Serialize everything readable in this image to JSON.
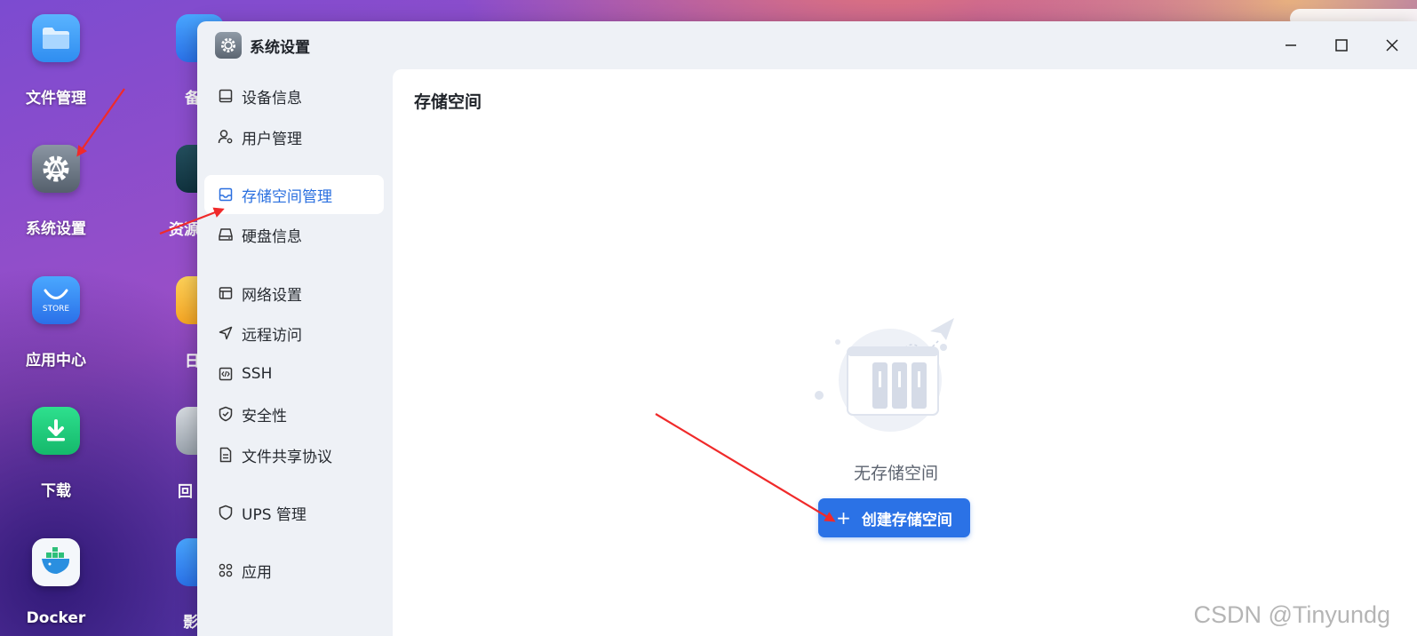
{
  "desktop": {
    "icons": [
      {
        "label": "文件管理",
        "icon": "folder-icon"
      },
      {
        "label": "系统设置",
        "icon": "gear-icon"
      },
      {
        "label": "应用中心",
        "icon": "store-icon"
      },
      {
        "label": "下载",
        "icon": "download-icon"
      },
      {
        "label": "Docker",
        "icon": "docker-icon"
      }
    ],
    "store_text": "STORE",
    "col2_labels": [
      "备",
      "资源",
      "日",
      "回",
      "影"
    ]
  },
  "window": {
    "title": "系统设置",
    "controls": {
      "minimize": "minimize-icon",
      "maximize": "maximize-icon",
      "close": "close-icon"
    }
  },
  "sidebar": {
    "items": [
      {
        "label": "设备信息",
        "icon": "device-icon"
      },
      {
        "label": "用户管理",
        "icon": "user-gear-icon"
      },
      {
        "label": "存储空间管理",
        "icon": "storage-icon",
        "active": true
      },
      {
        "label": "硬盘信息",
        "icon": "disk-icon"
      },
      {
        "label": "网络设置",
        "icon": "network-icon"
      },
      {
        "label": "远程访问",
        "icon": "remote-icon"
      },
      {
        "label": "SSH",
        "icon": "ssh-icon"
      },
      {
        "label": "安全性",
        "icon": "shield-check-icon"
      },
      {
        "label": "文件共享协议",
        "icon": "document-icon"
      },
      {
        "label": "UPS 管理",
        "icon": "shield-icon"
      },
      {
        "label": "应用",
        "icon": "apps-icon"
      }
    ]
  },
  "main": {
    "title": "存储空间",
    "empty_text": "无存储空间",
    "create_button": "创建存储空间",
    "plus": "+"
  },
  "watermark": "CSDN @Tinyundg",
  "colors": {
    "accent": "#2b72e6",
    "active_text": "#2a6fdf"
  }
}
